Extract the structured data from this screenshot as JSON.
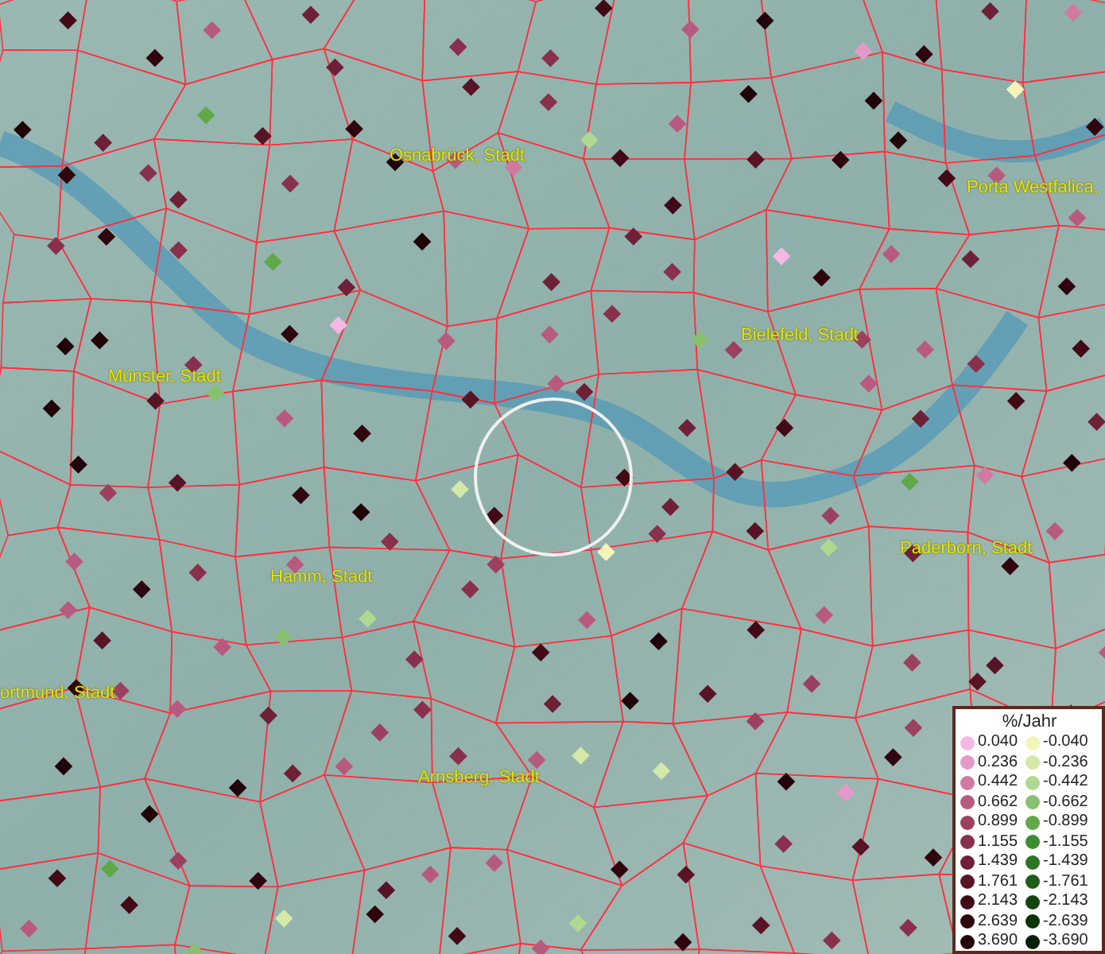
{
  "map": {
    "place_labels": [
      "Osnabrück, Stadt",
      "Porta Westfalica,",
      "Münster, Stadt",
      "Bielefeld, Stadt",
      "Paderborn, Stadt",
      "Hamm, Stadt",
      "ortmund, Stadt",
      "Arnsberg, Stadt"
    ]
  },
  "legend": {
    "title": "%/Jahr",
    "rows": [
      {
        "positive": {
          "label": "0.040",
          "color": "#f4b8e4"
        },
        "negative": {
          "label": "-0.040",
          "color": "#f2f4b8"
        }
      },
      {
        "positive": {
          "label": "0.236",
          "color": "#e49ac8"
        },
        "negative": {
          "label": "-0.236",
          "color": "#d4e8a8"
        }
      },
      {
        "positive": {
          "label": "0.442",
          "color": "#d07aa2"
        },
        "negative": {
          "label": "-0.442",
          "color": "#b0d890"
        }
      },
      {
        "positive": {
          "label": "0.662",
          "color": "#b85a80"
        },
        "negative": {
          "label": "-0.662",
          "color": "#88c070"
        }
      },
      {
        "positive": {
          "label": "0.899",
          "color": "#9c4060"
        },
        "negative": {
          "label": "-0.899",
          "color": "#60a848"
        }
      },
      {
        "positive": {
          "label": "1.155",
          "color": "#88304c"
        },
        "negative": {
          "label": "-1.155",
          "color": "#3e8c30"
        }
      },
      {
        "positive": {
          "label": "1.439",
          "color": "#6e2036"
        },
        "negative": {
          "label": "-1.439",
          "color": "#2c7424"
        }
      },
      {
        "positive": {
          "label": "1.761",
          "color": "#581424"
        },
        "negative": {
          "label": "-1.761",
          "color": "#1e5c18"
        }
      },
      {
        "positive": {
          "label": "2.143",
          "color": "#420a16"
        },
        "negative": {
          "label": "-2.143",
          "color": "#12460e"
        }
      },
      {
        "positive": {
          "label": "2.639",
          "color": "#30060e"
        },
        "negative": {
          "label": "-2.639",
          "color": "#0a3208"
        }
      },
      {
        "positive": {
          "label": "3.690",
          "color": "#200408"
        },
        "negative": {
          "label": "-3.690",
          "color": "#042004"
        }
      }
    ]
  }
}
